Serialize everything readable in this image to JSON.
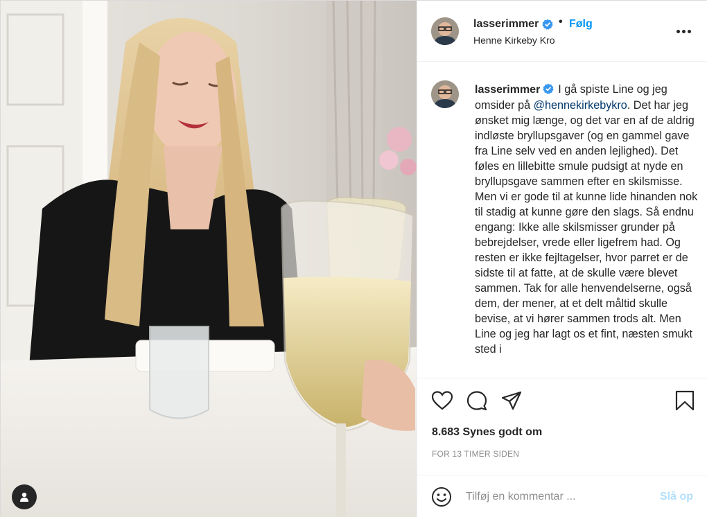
{
  "post": {
    "author": {
      "username": "lasserimmer",
      "verified": true
    },
    "follow_label": "Følg",
    "separator": "•",
    "location": "Henne Kirkeby Kro",
    "caption": {
      "before_mention": "I gå spiste Line og jeg omsider på",
      "mention": "@hennekirkebykro",
      "after_mention": ". Det har jeg ønsket mig længe, og det var en af de aldrig indløste bryllupsgaver (og en gammel gave fra Line selv ved en anden lejlighed). Det føles en lillebitte smule pudsigt at nyde en bryllupsgave sammen efter en skilsmisse. Men vi er gode til at kunne lide hinanden nok til stadig at kunne gøre den slags. Så endnu engang: Ikke alle skilsmisser grunder på bebrejdelser, vrede eller ligefrem had. Og resten er ikke fejltagelser, hvor parret er de sidste til at fatte, at de skulle være blevet sammen. Tak for alle henvendelserne, også dem, der mener, at et delt måltid skulle bevise, at vi hører sammen trods alt. Men Line og jeg har lagt os et fint, næsten smukt sted i"
    },
    "likes": "8.683 Synes godt om",
    "timestamp": "FOR 13 TIMER SIDEN"
  },
  "comment_box": {
    "placeholder": "Tilføj en kommentar ...",
    "post_label": "Slå op"
  },
  "icons": {
    "like": "heart-icon",
    "comment": "comment-bubble-icon",
    "share": "paper-plane-icon",
    "save": "bookmark-icon",
    "more": "more-options-icon",
    "emoji": "emoji-smiley-icon",
    "verified": "verified-badge-icon",
    "user_tags": "user-tag-icon"
  },
  "colors": {
    "link_blue": "#0095f6",
    "mention": "#00376b",
    "text": "#262626",
    "muted": "#8e8e8e",
    "post_disabled": "#b2dffc",
    "verified": "#3897f0"
  }
}
